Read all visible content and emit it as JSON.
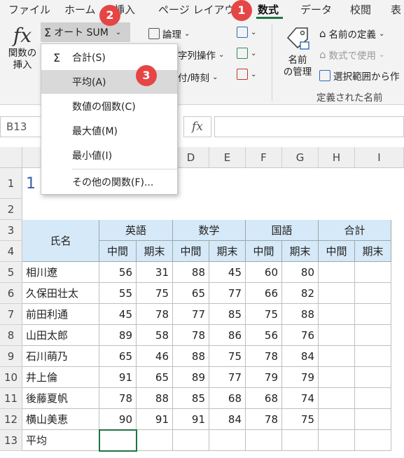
{
  "ribbon": {
    "tabs": [
      "ファイル",
      "ホーム",
      "挿入",
      "ページ レイアウト",
      "数式",
      "データ",
      "校閲",
      "表"
    ],
    "active_tab": "数式",
    "insert_function": {
      "line1": "関数の",
      "line2": "挿入"
    },
    "autosum_label": "オート SUM",
    "logical_label": "論理",
    "text_label": "字列操作",
    "datetime_label": "付/時刻",
    "name_manager": {
      "line1": "名前",
      "line2": "の管理"
    },
    "define_name": "名前の定義",
    "use_in_formula": "数式で使用",
    "create_from_selection": "選択範囲から作",
    "group_defined_names": "定義された名前"
  },
  "dropdown": {
    "items": [
      "合計(S)",
      "平均(A)",
      "数値の個数(C)",
      "最大値(M)",
      "最小値(I)",
      "その他の関数(F)..."
    ]
  },
  "badges": [
    "1",
    "2",
    "3"
  ],
  "formula_bar": {
    "name_box": "B13",
    "fx": "fx"
  },
  "sheet": {
    "col_headers": [
      "D",
      "E",
      "F",
      "G",
      "H",
      "I"
    ],
    "row_headers": [
      "1",
      "2",
      "3",
      "4",
      "5",
      "6",
      "7",
      "8",
      "9",
      "10",
      "11",
      "12",
      "13"
    ],
    "a1_partial": "1",
    "header_name": "氏名",
    "subjects": [
      "英語",
      "数学",
      "国語",
      "合計"
    ],
    "sub_headers": [
      "中間",
      "期末",
      "中間",
      "期末",
      "中間",
      "期末",
      "中間",
      "期末"
    ],
    "rows": [
      {
        "name": "相川遼",
        "scores": [
          "56",
          "31",
          "88",
          "45",
          "60",
          "80"
        ]
      },
      {
        "name": "久保田壮太",
        "scores": [
          "55",
          "75",
          "65",
          "77",
          "66",
          "82"
        ]
      },
      {
        "name": "前田利通",
        "scores": [
          "45",
          "78",
          "77",
          "85",
          "75",
          "88"
        ]
      },
      {
        "name": "山田太郎",
        "scores": [
          "89",
          "58",
          "78",
          "86",
          "56",
          "76"
        ]
      },
      {
        "name": "石川萌乃",
        "scores": [
          "65",
          "46",
          "88",
          "75",
          "78",
          "84"
        ]
      },
      {
        "name": "井上倫",
        "scores": [
          "91",
          "65",
          "89",
          "77",
          "79",
          "79"
        ]
      },
      {
        "name": "後藤夏帆",
        "scores": [
          "78",
          "88",
          "85",
          "68",
          "68",
          "74"
        ]
      },
      {
        "name": "横山美恵",
        "scores": [
          "90",
          "91",
          "91",
          "84",
          "78",
          "75"
        ]
      }
    ],
    "avg_label": "平均"
  },
  "colors": {
    "accent": "#217346",
    "badge": "#e64545",
    "header_fill": "#d6e9f8"
  }
}
